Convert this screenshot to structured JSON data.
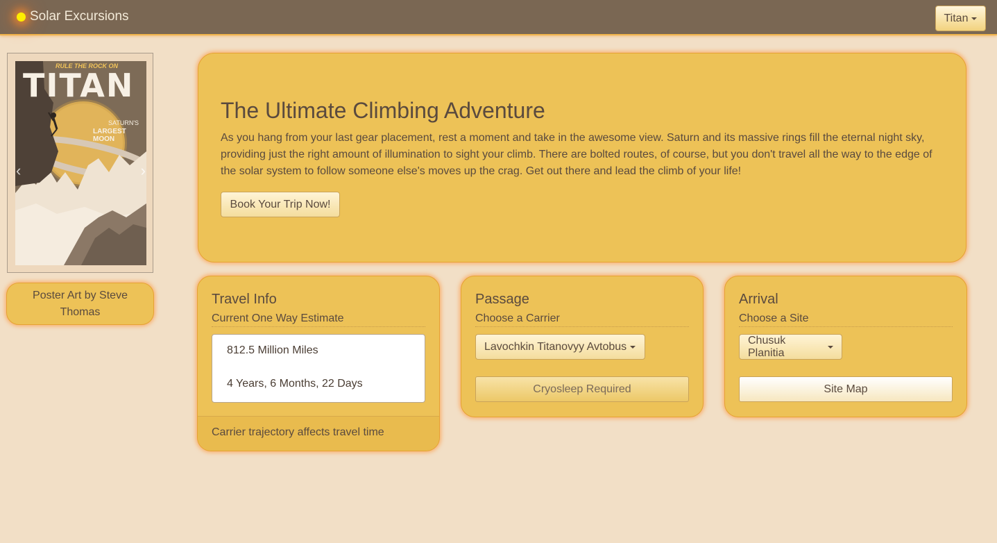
{
  "nav": {
    "brand": "Solar Excursions",
    "destination": "Titan"
  },
  "poster": {
    "tagline_top": "RULE THE ROCK ON",
    "title": "TITAN",
    "subtitle_line1": "SATURN'S",
    "subtitle_line2": "LARGEST MOON",
    "credit": "Poster Art by  Steve Thomas"
  },
  "hero": {
    "title": "The Ultimate Climbing Adventure",
    "body": "As you hang from your last gear placement, rest a moment and take in the awesome view. Saturn and its massive rings fill the eternal night sky, providing just the right amount of illumination to sight your climb. There are bolted routes, of course, but you don't travel all the way to the edge of the solar system to follow someone else's moves up the crag. Get out there and lead the climb of your life!",
    "button": "Book Your Trip Now!"
  },
  "travel": {
    "title": "Travel Info",
    "subtitle": "Current One Way Estimate",
    "distance": "812.5 Million Miles",
    "duration": "4 Years, 6 Months, 22 Days",
    "footer": "Carrier trajectory affects travel time"
  },
  "passage": {
    "title": "Passage",
    "subtitle": "Choose a Carrier",
    "carrier": "Lavochkin Titanovyy Avtobus",
    "button": "Cryosleep Required"
  },
  "arrival": {
    "title": "Arrival",
    "subtitle": "Choose a Site",
    "site": "Chusuk Planitia",
    "button": "Site Map"
  },
  "colors": {
    "page_bg": "#f2dfc6",
    "navbar": "#7a6753",
    "card": "#edc257",
    "glow": "#ff8c28"
  }
}
